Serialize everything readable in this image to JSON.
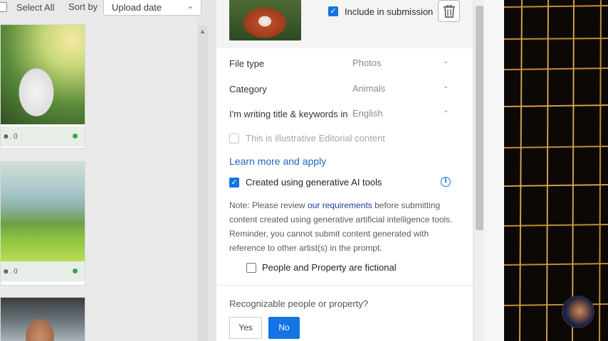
{
  "toolbar": {
    "select_all": "Select All",
    "sort_by": "Sort by",
    "sort_value": "Upload date"
  },
  "thumbnails": [
    {
      "subject": "rabbit",
      "count": "0"
    },
    {
      "subject": "mountains",
      "count": "0"
    },
    {
      "subject": "person"
    }
  ],
  "panel": {
    "include_label": "Include in submission",
    "include_checked": true,
    "fields": [
      {
        "label": "File type",
        "value": "Photos"
      },
      {
        "label": "Category",
        "value": "Animals"
      },
      {
        "label": "I'm writing title & keywords in",
        "value": "English"
      }
    ],
    "editorial_label": "This is illustrative Editorial content",
    "learn_link": "Learn more and apply",
    "ai_label": "Created using generative AI tools",
    "ai_checked": true,
    "note_prefix": "Note: Please review ",
    "note_link": "our requirements",
    "note_suffix": " before submitting content created using generative artificial intelligence tools. Reminder, you cannot submit content generated with reference to other artist(s) in the prompt.",
    "fictional_label": "People and Property are fictional",
    "recognizable_q": "Recognizable people or property?",
    "yes_label": "Yes",
    "no_label": "No",
    "selected_answer": "No"
  },
  "colors": {
    "accent": "#1473e6",
    "link": "#1a66c9",
    "status_green": "#33a852"
  },
  "icons": {
    "chevron": "chevron-down-icon",
    "trash": "trash-icon",
    "info": "info-icon"
  }
}
